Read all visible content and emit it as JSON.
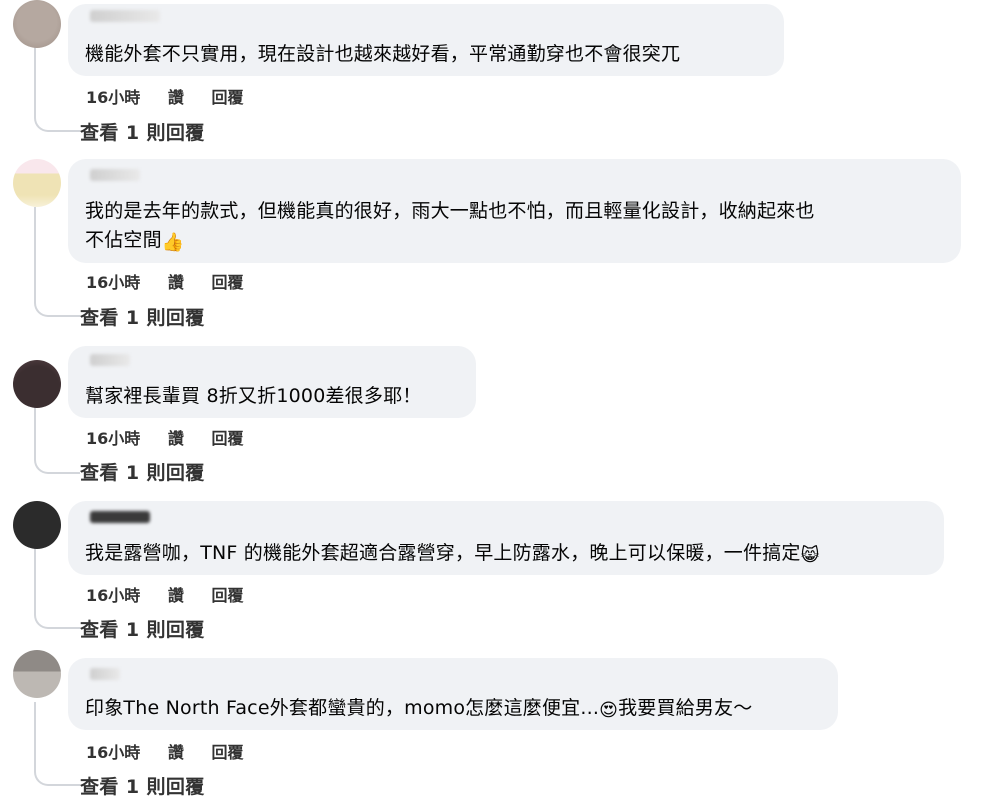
{
  "comments": [
    {
      "text_lines": [
        "機能外套不只實用，現在設計也越來越好看，平常通勤穿也不會很突兀"
      ],
      "time": "16小時",
      "like": "讚",
      "reply": "回覆",
      "view_replies": "查看 1 則回覆"
    },
    {
      "text_lines": [
        "我的是去年的款式，但機能真的很好，雨大一點也不怕，而且輕量化設計，收納起來也",
        "不佔空間"
      ],
      "emoji": "👍",
      "time": "16小時",
      "like": "讚",
      "reply": "回覆",
      "view_replies": "查看 1 則回覆"
    },
    {
      "text_lines": [
        "幫家裡長輩買 8折又折1000差很多耶！"
      ],
      "time": "16小時",
      "like": "讚",
      "reply": "回覆",
      "view_replies": "查看 1 則回覆"
    },
    {
      "text_lines": [
        "我是露營咖，TNF 的機能外套超適合露營穿，早上防露水，晚上可以保暖，一件搞定"
      ],
      "emoji": "😸",
      "time": "16小時",
      "like": "讚",
      "reply": "回覆",
      "view_replies": "查看 1 則回覆"
    },
    {
      "text_before": "印象The North Face外套都蠻貴的，momo怎麼這麼便宜...",
      "emoji": "😍",
      "text_after": "我要買給男友～",
      "time": "16小時",
      "like": "讚",
      "reply": "回覆",
      "view_replies": "查看 1 則回覆"
    }
  ]
}
